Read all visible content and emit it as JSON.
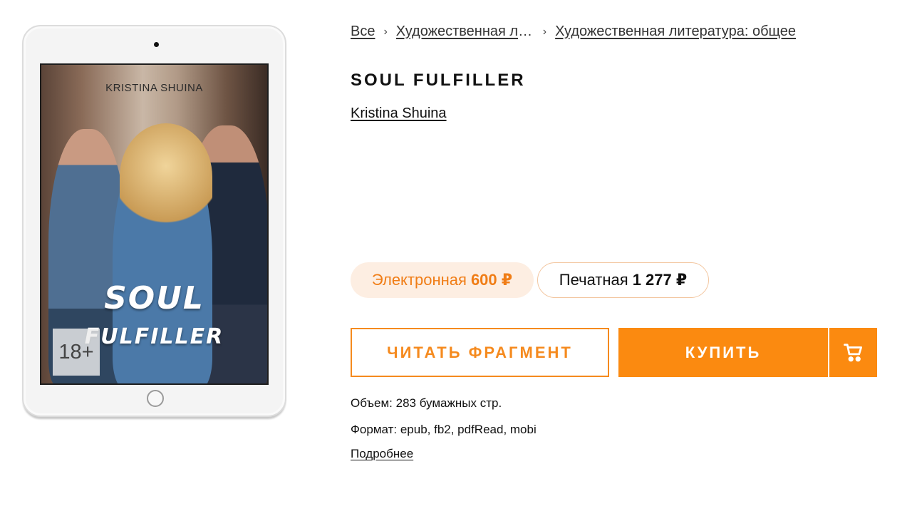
{
  "breadcrumb": {
    "items": [
      "Все",
      "Художественная ли…",
      "Художественная литература: общее"
    ],
    "separator": "›"
  },
  "book": {
    "title": "SOUL FULFILLER",
    "author": "Kristina Shuina"
  },
  "cover": {
    "author": "KRISTINA SHUINA",
    "title_line1": "SOUL",
    "title_line2": "FULFILLER",
    "age_rating": "18+"
  },
  "prices": {
    "ebook_label": "Электронная",
    "ebook_price": "600 ₽",
    "print_label": "Печатная",
    "print_price": "1 277 ₽"
  },
  "actions": {
    "read_fragment": "ЧИТАТЬ ФРАГМЕНТ",
    "buy": "КУПИТЬ",
    "cart_icon": "cart-icon"
  },
  "meta": {
    "volume": "Объем: 283 бумажных стр.",
    "format": "Формат: epub, fb2, pdfRead, mobi",
    "more": "Подробнее"
  },
  "colors": {
    "accent": "#fb8a10",
    "accent_light": "#fdeee2"
  }
}
